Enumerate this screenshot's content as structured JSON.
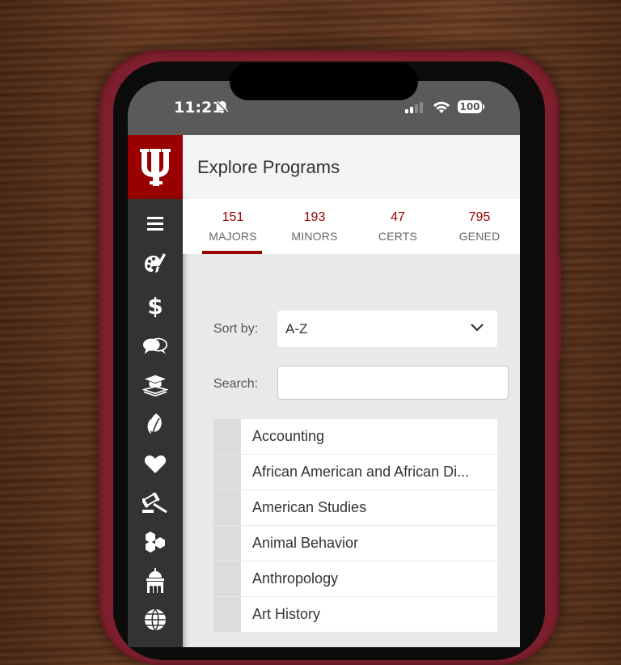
{
  "status_bar": {
    "time": "11:21",
    "battery": "100",
    "icons": [
      "bell-slash-icon",
      "signal-icon",
      "wifi-icon",
      "battery-icon"
    ]
  },
  "header": {
    "logo": "iu-trident-logo",
    "title": "Explore Programs"
  },
  "sidebar": {
    "items": [
      {
        "icon": "menu-icon",
        "label": "Menu"
      },
      {
        "icon": "palette-icon",
        "label": "Arts"
      },
      {
        "icon": "dollar-icon",
        "label": "Business"
      },
      {
        "icon": "chat-bubbles-icon",
        "label": "Communication"
      },
      {
        "icon": "graduation-cap-icon",
        "label": "Education"
      },
      {
        "icon": "leaf-icon",
        "label": "Environment"
      },
      {
        "icon": "heart-icon",
        "label": "Health"
      },
      {
        "icon": "gavel-icon",
        "label": "Law"
      },
      {
        "icon": "hexagons-icon",
        "label": "Science"
      },
      {
        "icon": "building-icon",
        "label": "Culture"
      },
      {
        "icon": "globe-icon",
        "label": "Global"
      }
    ]
  },
  "tabs": [
    {
      "count": "151",
      "label": "MAJORS",
      "active": true
    },
    {
      "count": "193",
      "label": "MINORS",
      "active": false
    },
    {
      "count": "47",
      "label": "CERTS",
      "active": false
    },
    {
      "count": "795",
      "label": "GENED",
      "active": false
    }
  ],
  "filters": {
    "sort_label": "Sort by:",
    "sort_value": "A-Z",
    "search_label": "Search:",
    "search_value": "",
    "search_placeholder": ""
  },
  "programs": [
    "Accounting",
    "African American and African Di...",
    "American Studies",
    "Animal Behavior",
    "Anthropology",
    "Art History"
  ],
  "colors": {
    "accent": "#990000",
    "sidebar": "#333333",
    "case": "#7d1f2c"
  }
}
